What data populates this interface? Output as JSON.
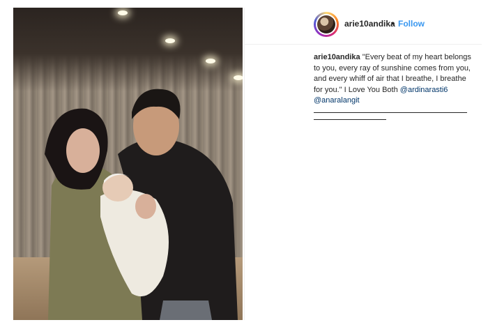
{
  "post": {
    "username": "arie10andika",
    "separator": "•",
    "follow_label": "Follow",
    "caption": {
      "username": "arie10andika",
      "text": "\"Every beat of my heart belongs to you, every ray of sunshine comes from you, and every whiff of air that I breathe, I breathe for you.\" I Love You Both",
      "mention_1": "@ardinarasti6",
      "mention_2": "@anaralangit"
    }
  },
  "colors": {
    "link": "#3897f0",
    "mention": "#003569",
    "text": "#262626"
  }
}
